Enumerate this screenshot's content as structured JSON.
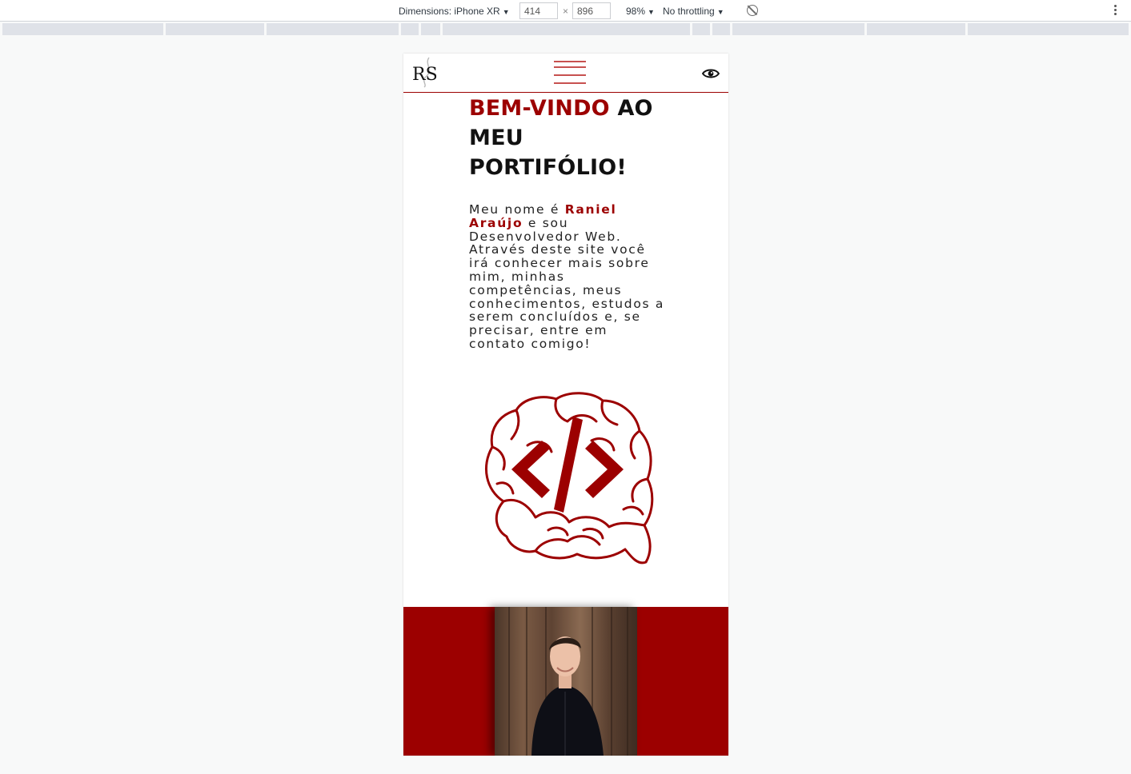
{
  "devtools": {
    "dimensions_label": "Dimensions: iPhone XR",
    "width_value": "414",
    "times": "×",
    "height_value": "896",
    "zoom": "98%",
    "throttling": "No throttling"
  },
  "nav": {
    "logo_text": "RS",
    "accent_color": "#9c0000"
  },
  "hero": {
    "title_accent": "BEM-VINDO",
    "title_rest": " AO MEU PORTIFÓLIO!",
    "intro_before": "Meu nome é ",
    "name": "Raniel Araújo",
    "intro_after": " e sou Desenvolvedor Web. Através deste site você irá conhecer mais sobre mim, minhas competências, meus conhecimentos, estudos a serem concluídos e, se precisar, entre em contato comigo!",
    "code_symbol": "</>"
  },
  "about": {
    "background_color": "#9c0000"
  }
}
